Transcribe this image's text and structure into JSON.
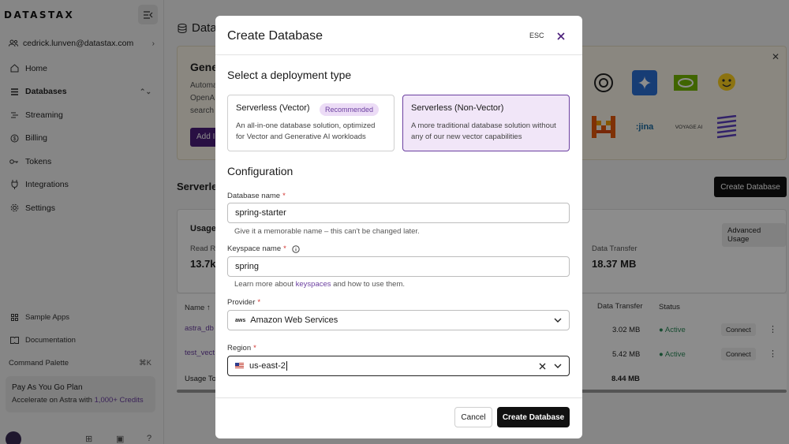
{
  "sidebar": {
    "logo": "DATASTAX",
    "user": "cedrick.lunven@datastax.com",
    "items": [
      {
        "label": "Home",
        "icon": "home-icon"
      },
      {
        "label": "Databases",
        "icon": "database-icon"
      },
      {
        "label": "Streaming",
        "icon": "streaming-icon"
      },
      {
        "label": "Billing",
        "icon": "billing-icon"
      },
      {
        "label": "Tokens",
        "icon": "key-icon"
      },
      {
        "label": "Integrations",
        "icon": "plug-icon"
      },
      {
        "label": "Settings",
        "icon": "gear-icon"
      }
    ],
    "bottom": [
      {
        "label": "Sample Apps",
        "icon": "apps-icon"
      },
      {
        "label": "Documentation",
        "icon": "book-icon"
      }
    ],
    "command_palette": {
      "label": "Command Palette",
      "shortcut": "⌘K"
    },
    "plan": {
      "title": "Pay As You Go Plan",
      "prefix": "Accelerate on Astra with",
      "link": "1,000+ Credits"
    }
  },
  "background": {
    "page_title": "Databa",
    "gen_title": "Gene",
    "gen_lines": [
      "Automa",
      "OpenA",
      "search"
    ],
    "gen_add": "Add I",
    "logo_vendors": [
      "openai",
      "gemini",
      "nvidia",
      "huggingface",
      "mistral",
      "jina",
      "VOYAGE AI",
      "cohere"
    ],
    "serverless_title": "Serverle",
    "create_db_label": "Create Database",
    "usage_title": "Usage",
    "advanced_usage": "Advanced Usage",
    "read_label": "Read R",
    "read_value": "13.7k",
    "data_transfer_label": "Data Transfer",
    "data_transfer_value": "18.37 MB",
    "table": {
      "headers": {
        "name": "Name ↑",
        "data_transfer": "Data Transfer",
        "status": "Status"
      },
      "rows": [
        {
          "name": "astra_db",
          "data_transfer": "3.02 MB",
          "status": "Active",
          "action": "Connect"
        },
        {
          "name": "test_vect",
          "data_transfer": "5.42 MB",
          "status": "Active",
          "action": "Connect"
        }
      ],
      "total_label": "Usage To",
      "total_value": "8.44 MB"
    }
  },
  "modal": {
    "title": "Create Database",
    "esc_label": "ESC",
    "deployment_title": "Select a deployment type",
    "deployment_options": [
      {
        "title": "Serverless (Vector)",
        "badge": "Recommended",
        "desc": "An all-in-one database solution, optimized for Vector and Generative AI workloads",
        "selected": false
      },
      {
        "title": "Serverless (Non-Vector)",
        "desc": "A more traditional database solution without any of our new vector capabilities",
        "selected": true
      }
    ],
    "config_title": "Configuration",
    "db_name": {
      "label": "Database name",
      "required": "*",
      "value": "spring-starter",
      "help": "Give it a memorable name – this can't be changed later."
    },
    "keyspace": {
      "label": "Keyspace name",
      "required": "*",
      "value": "spring",
      "help_prefix": "Learn more about",
      "help_link": "keyspaces",
      "help_suffix": "and how to use them."
    },
    "provider": {
      "label": "Provider",
      "required": "*",
      "logo": "aws",
      "value": "Amazon Web Services"
    },
    "region": {
      "label": "Region",
      "required": "*",
      "value": "us-east-2"
    },
    "cancel_label": "Cancel",
    "create_label": "Create Database"
  },
  "colors": {
    "accent": "#6b3fa0",
    "selected_bg": "#f1e6f8",
    "primary_button": "#111111",
    "active_status": "#2d8a5a"
  }
}
